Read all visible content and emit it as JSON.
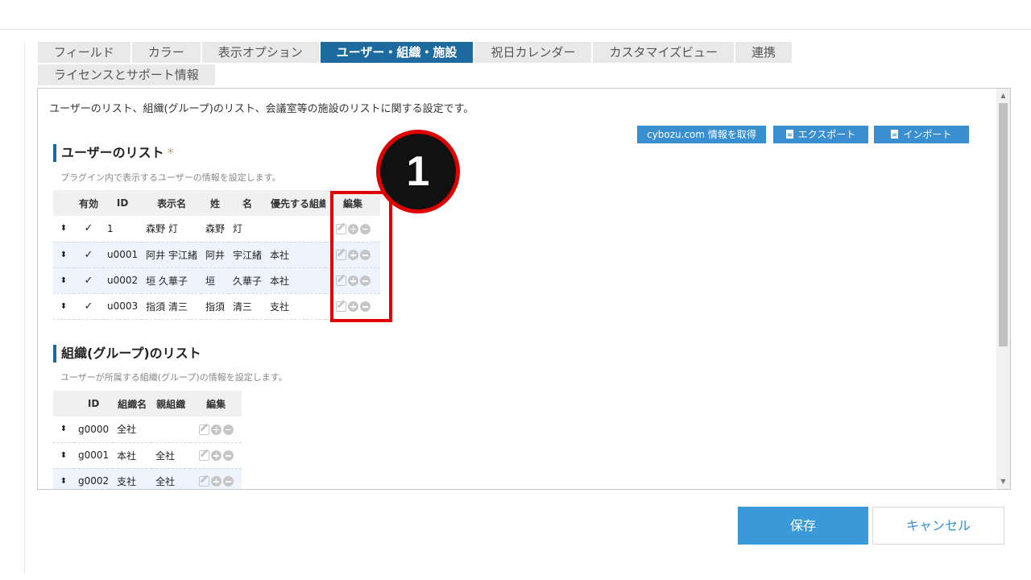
{
  "tabs": {
    "row1": [
      "フィールド",
      "カラー",
      "表示オプション",
      "ユーザー・組織・施設",
      "祝日カレンダー",
      "カスタマイズビュー",
      "連携"
    ],
    "row2": [
      "ライセンスとサポート情報"
    ],
    "active": "ユーザー・組織・施設"
  },
  "panel": {
    "description": "ユーザーのリスト、組織(グループ)のリスト、会議室等の施設のリストに関する設定です。",
    "buttons": {
      "fetch": "cybozu.com 情報を取得",
      "export": "エクスポート",
      "import": "インポート"
    }
  },
  "users": {
    "title": "ユーザーのリスト",
    "required_mark": "*",
    "description": "プラグイン内で表示するユーザーの情報を設定します。",
    "columns": [
      "有効",
      "ID",
      "表示名",
      "姓",
      "名",
      "優先する組織",
      "編集"
    ],
    "rows": [
      {
        "enabled": "✓",
        "id": "1",
        "display": "森野 灯",
        "last": "森野",
        "first": "灯",
        "org": ""
      },
      {
        "enabled": "✓",
        "id": "u0001",
        "display": "阿井 宇江緒",
        "last": "阿井",
        "first": "宇江緒",
        "org": "本社"
      },
      {
        "enabled": "✓",
        "id": "u0002",
        "display": "垣 久華子",
        "last": "垣",
        "first": "久華子",
        "org": "本社"
      },
      {
        "enabled": "✓",
        "id": "u0003",
        "display": "指須 清三",
        "last": "指須",
        "first": "清三",
        "org": "支社"
      }
    ]
  },
  "groups": {
    "title": "組織(グループ)のリスト",
    "description": "ユーザーが所属する組織(グループ)の情報を設定します。",
    "columns": [
      "ID",
      "組織名",
      "親組織",
      "編集"
    ],
    "rows": [
      {
        "id": "g0000",
        "name": "全社",
        "parent": ""
      },
      {
        "id": "g0001",
        "name": "本社",
        "parent": "全社"
      },
      {
        "id": "g0002",
        "name": "支社",
        "parent": "全社"
      }
    ]
  },
  "annotation": {
    "step": "1",
    "color": "#e00000"
  },
  "footer": {
    "save": "保存",
    "cancel": "キャンセル"
  },
  "colors": {
    "accent": "#1c6a9e",
    "button": "#3a9ad9"
  }
}
